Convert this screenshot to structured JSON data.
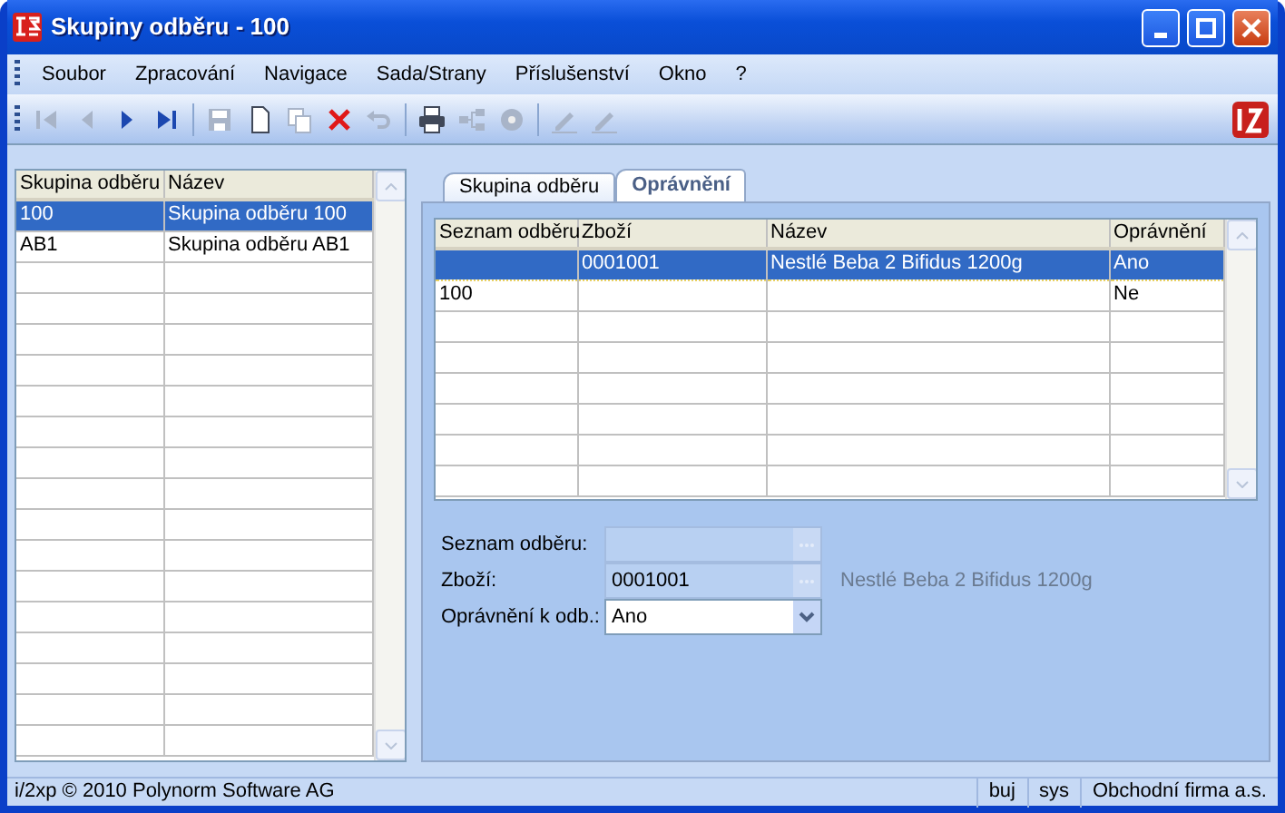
{
  "window": {
    "title": "Skupiny odběru - 100"
  },
  "menu": [
    "Soubor",
    "Zpracování",
    "Navigace",
    "Sada/Strany",
    "Příslušenství",
    "Okno",
    "?"
  ],
  "toolbar": [
    {
      "kind": "first",
      "disabled": true
    },
    {
      "kind": "prev",
      "disabled": true
    },
    {
      "kind": "next",
      "disabled": false
    },
    {
      "kind": "last",
      "disabled": false
    },
    {
      "kind": "separator"
    },
    {
      "kind": "save",
      "disabled": true
    },
    {
      "kind": "new",
      "disabled": false
    },
    {
      "kind": "copy",
      "disabled": true
    },
    {
      "kind": "delete",
      "disabled": false
    },
    {
      "kind": "undo",
      "disabled": true
    },
    {
      "kind": "separator"
    },
    {
      "kind": "print",
      "disabled": false
    },
    {
      "kind": "tree",
      "disabled": true
    },
    {
      "kind": "disc",
      "disabled": true
    },
    {
      "kind": "separator"
    },
    {
      "kind": "pencil",
      "disabled": true
    },
    {
      "kind": "pencil",
      "disabled": true
    }
  ],
  "groups_table": {
    "columns": [
      "Skupina odběru",
      "Název"
    ],
    "rows": [
      {
        "cells": [
          "100",
          "Skupina odběru 100"
        ],
        "selected": true
      },
      {
        "cells": [
          "AB1",
          "Skupina odběru AB1"
        ],
        "selected": false
      }
    ]
  },
  "tabs": [
    {
      "label": "Skupina odběru",
      "selected": false
    },
    {
      "label": "Oprávnění",
      "selected": true
    }
  ],
  "permissions_table": {
    "columns": [
      "Seznam odběru",
      "Zboží",
      "Název",
      "Oprávnění"
    ],
    "rows": [
      {
        "cells": [
          null,
          "0001001",
          "Nestlé Beba 2 Bifidus 1200g",
          "Ano"
        ],
        "selected": true
      },
      {
        "cells": [
          "100",
          null,
          null,
          "Ne"
        ],
        "selected": false
      }
    ]
  },
  "form": {
    "fields": [
      {
        "label": "Seznam odběru:",
        "kind": "lookup",
        "disabled": true
      },
      {
        "label": "Zboží:",
        "kind": "lookup",
        "value": "0001001",
        "disabled": true,
        "description": "Nestlé Beba 2 Bifidus 1200g"
      },
      {
        "label": "Oprávnění k odb.:",
        "kind": "select",
        "value": "Ano",
        "disabled": false
      }
    ]
  },
  "status_bar": {
    "copyright": "i/2xp © 2010 Polynorm Software AG",
    "items": [
      "buj",
      "sys",
      "Obchodní firma a.s."
    ]
  }
}
